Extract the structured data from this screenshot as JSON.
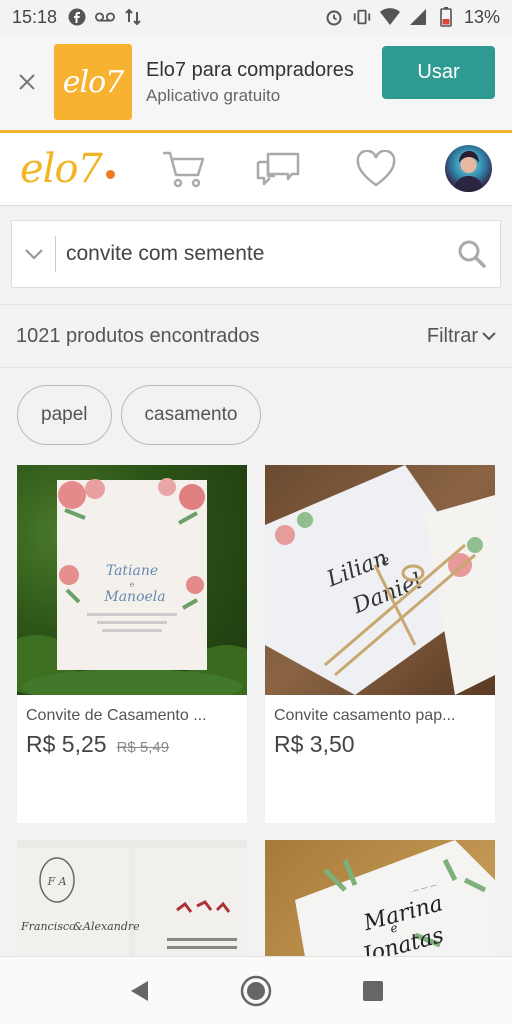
{
  "status_bar": {
    "time": "15:18",
    "battery": "13%"
  },
  "app_banner": {
    "logo_text": "elo7",
    "title": "Elo7 para compradores",
    "subtitle": "Aplicativo gratuito",
    "button_label": "Usar"
  },
  "header": {
    "logo_text": "elo7"
  },
  "search": {
    "value": "convite com semente",
    "placeholder": ""
  },
  "results": {
    "count_text": "1021 produtos encontrados",
    "filter_label": "Filtrar"
  },
  "chips": [
    "papel",
    "casamento"
  ],
  "products": [
    {
      "title": "Convite de Casamento ...",
      "price": "R$ 5,25",
      "old_price": "R$ 5,49",
      "img_names": [
        "Tatiane",
        "e",
        "Manoela"
      ]
    },
    {
      "title": "Convite casamento pap...",
      "price": "R$ 3,50",
      "old_price": "",
      "img_names": [
        "Lilian",
        "e",
        "Daniel"
      ]
    },
    {
      "title": "",
      "price": "",
      "old_price": "",
      "img_names": [
        "Francisco",
        "&",
        "Alexandre"
      ]
    },
    {
      "title": "",
      "price": "",
      "old_price": "",
      "img_names": [
        "Marina",
        "e",
        "Jonatas"
      ]
    }
  ],
  "colors": {
    "brand_yellow": "#f1b524",
    "brand_orange": "#f07a22",
    "teal": "#2f9a92"
  },
  "icons": [
    "close-icon",
    "cart-icon",
    "chat-icon",
    "heart-icon",
    "chevron-down-icon",
    "search-icon",
    "back-icon",
    "home-icon",
    "recents-icon"
  ]
}
